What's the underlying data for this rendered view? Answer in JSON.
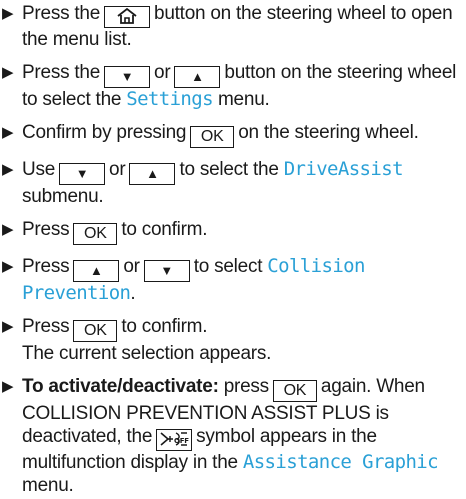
{
  "steps": [
    {
      "a": "Press the",
      "b": "button on the steering wheel to open the menu list."
    },
    {
      "a": "Press the",
      "or": "or",
      "b": "button on the steering wheel to select the",
      "menu": "Settings",
      "c": "menu."
    },
    {
      "a": "Confirm by pressing",
      "key": "OK",
      "b": "on the steering wheel."
    },
    {
      "a": "Use",
      "or": "or",
      "b": "to select the",
      "menu": "DriveAssist",
      "c": "submenu."
    },
    {
      "a": "Press",
      "key": "OK",
      "b": "to confirm."
    },
    {
      "a": "Press",
      "or": "or",
      "b": "to select",
      "menu": "Collision Prevention",
      "c": "."
    },
    {
      "a": "Press",
      "key": "OK",
      "b": "to confirm.",
      "c": "The current selection appears."
    },
    {
      "bold": "To activate/deactivate:",
      "a": "press",
      "key": "OK",
      "b": "again. When COLLISION PREVENTION ASSIST PLUS is deactivated, the",
      "c": "symbol appears in the multifunction display in the",
      "menu": "Assistance Graphic",
      "d": "menu."
    }
  ],
  "bullet_glyph": "▶",
  "arrow_down": "▼",
  "arrow_up": "▲"
}
